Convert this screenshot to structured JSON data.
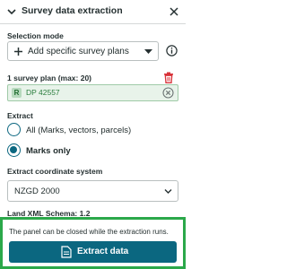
{
  "header": {
    "title": "Survey data extraction"
  },
  "selection": {
    "label": "Selection mode",
    "value": "Add specific survey plans"
  },
  "plans": {
    "count_label": "1 survey plan (max: 20)",
    "items": [
      {
        "badge": "R",
        "name": "DP 42557"
      }
    ]
  },
  "extract": {
    "label": "Extract",
    "options": [
      {
        "label": "All (Marks, vectors, parcels)",
        "selected": false
      },
      {
        "label": "Marks only",
        "selected": true
      }
    ]
  },
  "coord": {
    "label": "Extract coordinate system",
    "value": "NZGD 2000"
  },
  "schema": "Land XML Schema: 1.2",
  "footer": {
    "note": "The panel can be closed while the extraction runs.",
    "button_label": "Extract data"
  },
  "colors": {
    "primary": "#0b6780",
    "highlight_border": "#2ba84a",
    "plan_bg": "#e8f3ea",
    "plan_text": "#2a7d3d",
    "delete_red": "#d8333a"
  },
  "icons": [
    "chevron-down-icon",
    "close-icon",
    "info-icon",
    "trash-icon",
    "remove-circle-icon",
    "document-icon"
  ]
}
